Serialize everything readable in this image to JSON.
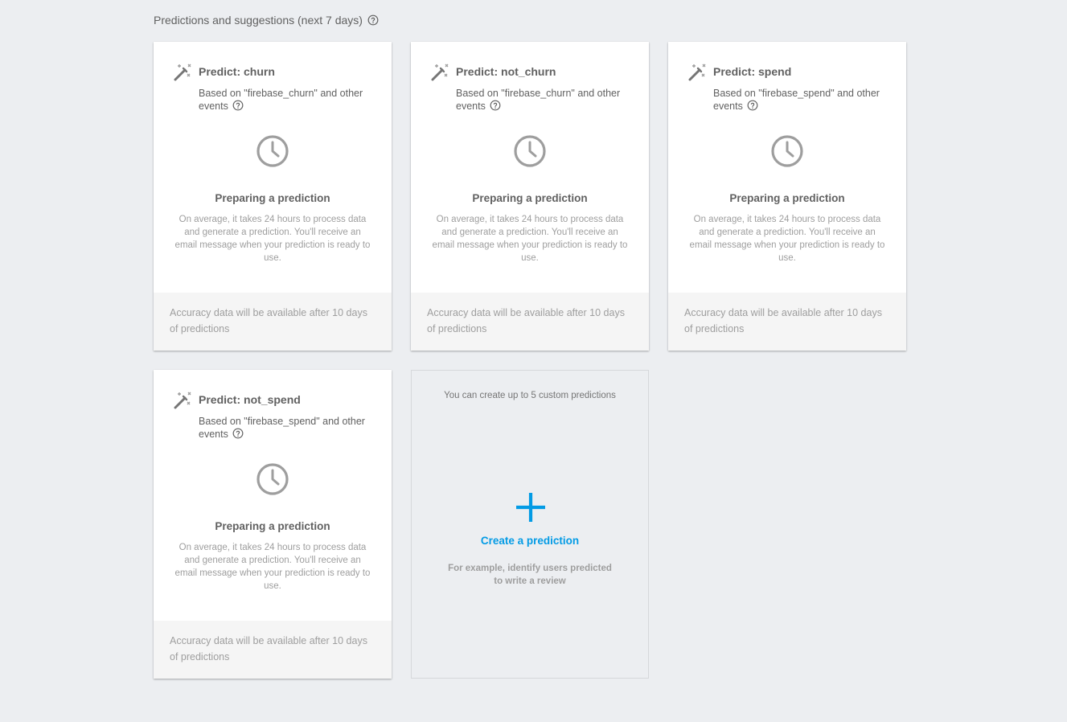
{
  "section": {
    "title": "Predictions and suggestions (next 7 days)"
  },
  "cards": [
    {
      "title": "Predict: churn",
      "based_on": "Based on \"firebase_churn\" and other events",
      "status_title": "Preparing a prediction",
      "status_desc": "On average, it takes 24 hours to process data and generate a prediction. You'll receive an email message when your prediction is ready to use.",
      "footer": "Accuracy data will be available after 10 days of predictions"
    },
    {
      "title": "Predict: not_churn",
      "based_on": "Based on \"firebase_churn\" and other events",
      "status_title": "Preparing a prediction",
      "status_desc": "On average, it takes 24 hours to process data and generate a prediction. You'll receive an email message when your prediction is ready to use.",
      "footer": "Accuracy data will be available after 10 days of predictions"
    },
    {
      "title": "Predict: spend",
      "based_on": "Based on \"firebase_spend\" and other events",
      "status_title": "Preparing a prediction",
      "status_desc": "On average, it takes 24 hours to process data and generate a prediction. You'll receive an email message when your prediction is ready to use.",
      "footer": "Accuracy data will be available after 10 days of predictions"
    },
    {
      "title": "Predict: not_spend",
      "based_on": "Based on \"firebase_spend\" and other events",
      "status_title": "Preparing a prediction",
      "status_desc": "On average, it takes 24 hours to process data and generate a prediction. You'll receive an email message when your prediction is ready to use.",
      "footer": "Accuracy data will be available after 10 days of predictions"
    }
  ],
  "create": {
    "limit_text": "You can create up to 5 custom predictions",
    "label": "Create a prediction",
    "example": "For example, identify users predicted to write a review"
  },
  "icons": {
    "help": "help-circle-icon",
    "wand": "magic-wand-icon",
    "clock": "clock-icon",
    "plus": "plus-icon"
  },
  "colors": {
    "background": "#eceef1",
    "accent": "#039be5",
    "icon_gray": "#9e9e9e",
    "text_dark": "#616161"
  }
}
